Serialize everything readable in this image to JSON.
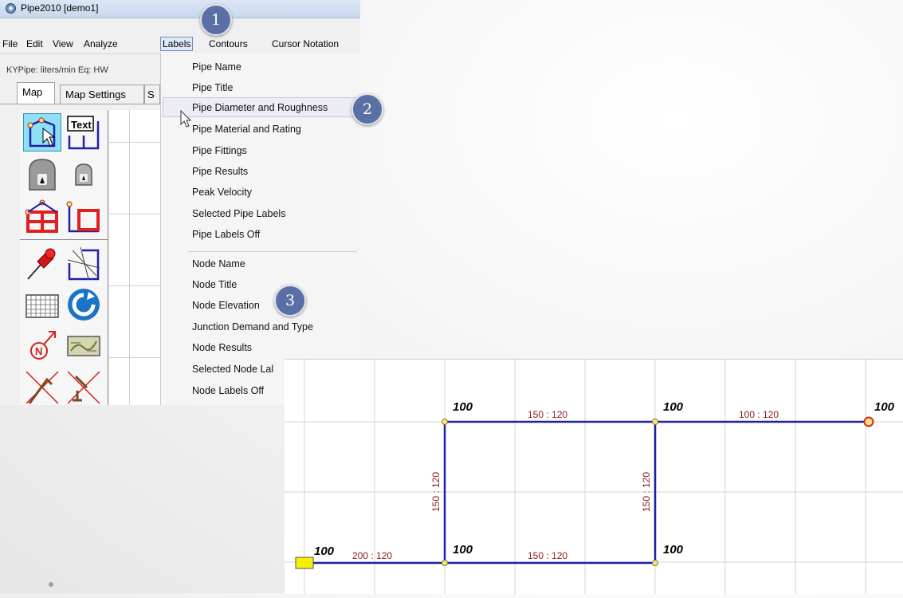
{
  "window": {
    "title": "Pipe2010  [demo1]"
  },
  "menubar": [
    {
      "label": "File"
    },
    {
      "label": "Edit"
    },
    {
      "label": "View"
    },
    {
      "label": "Analyze"
    },
    {
      "label": "Labels",
      "active": true
    },
    {
      "label": "Contours"
    },
    {
      "label": "Cursor Notation"
    }
  ],
  "status_text": "KYPipe: liters/min  Eq: HW",
  "tabs": [
    {
      "label": "Map",
      "selected": true
    },
    {
      "label": "Map Settings"
    },
    {
      "label": "S"
    }
  ],
  "toolbar_text_tool": "Text",
  "labels_menu": {
    "items": [
      "Pipe Name",
      "Pipe Title",
      "Pipe Diameter and Roughness",
      "Pipe Material and Rating",
      "Pipe Fittings",
      "Pipe Results",
      "Peak Velocity",
      "Selected Pipe Labels",
      "Pipe Labels Off",
      "Node Name",
      "Node Title",
      "Node Elevation",
      "Junction Demand and Type",
      "Node Results",
      "Selected Node Lal",
      "Node Labels Off"
    ],
    "highlighted": "Pipe Diameter and Roughness"
  },
  "callouts": [
    "1",
    "2",
    "3"
  ],
  "network": {
    "node_labels": [
      "100",
      "100",
      "100",
      "100",
      "100",
      "100"
    ],
    "pipe_labels": [
      "150 : 120",
      "100 : 120",
      "150 : 120",
      "150 : 120",
      "200 : 120",
      "150 : 120"
    ]
  },
  "colors": {
    "pipe": "#1f1fa8",
    "pipe_label": "#8b1a1a",
    "reservoir": "#f5f000",
    "node": "#f3e97a",
    "tank_outline": "#e02020",
    "callout": "#5a6fa4",
    "tool_selected": "#8fe0f5"
  }
}
